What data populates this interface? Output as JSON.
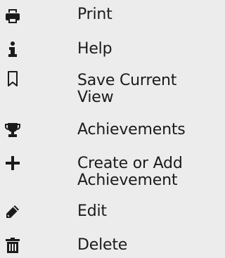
{
  "menu": {
    "items": [
      {
        "label": "Print",
        "icon": "printer-icon"
      },
      {
        "label": "Help",
        "icon": "info-icon"
      },
      {
        "label": "Save Current\nView",
        "icon": "bookmark-icon"
      },
      {
        "label": "Achievements",
        "icon": "trophy-icon"
      },
      {
        "label": "Create or Add\nAchievement",
        "icon": "plus-icon"
      },
      {
        "label": "Edit",
        "icon": "pencil-icon"
      },
      {
        "label": "Delete",
        "icon": "trash-icon"
      }
    ]
  }
}
